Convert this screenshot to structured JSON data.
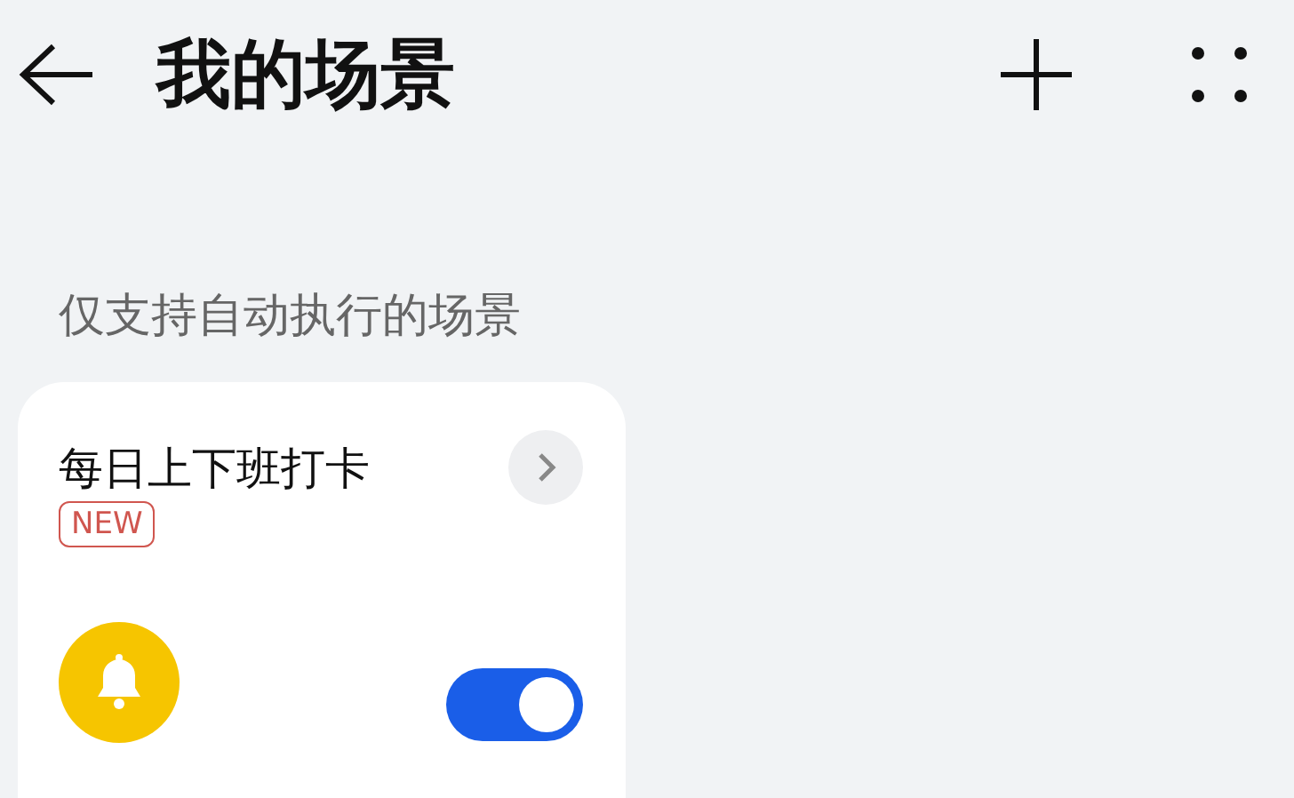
{
  "header": {
    "title": "我的场景"
  },
  "section": {
    "label": "仅支持自动执行的场景"
  },
  "scenes": [
    {
      "title": "每日上下班打卡",
      "badge": "NEW",
      "on": true
    }
  ]
}
